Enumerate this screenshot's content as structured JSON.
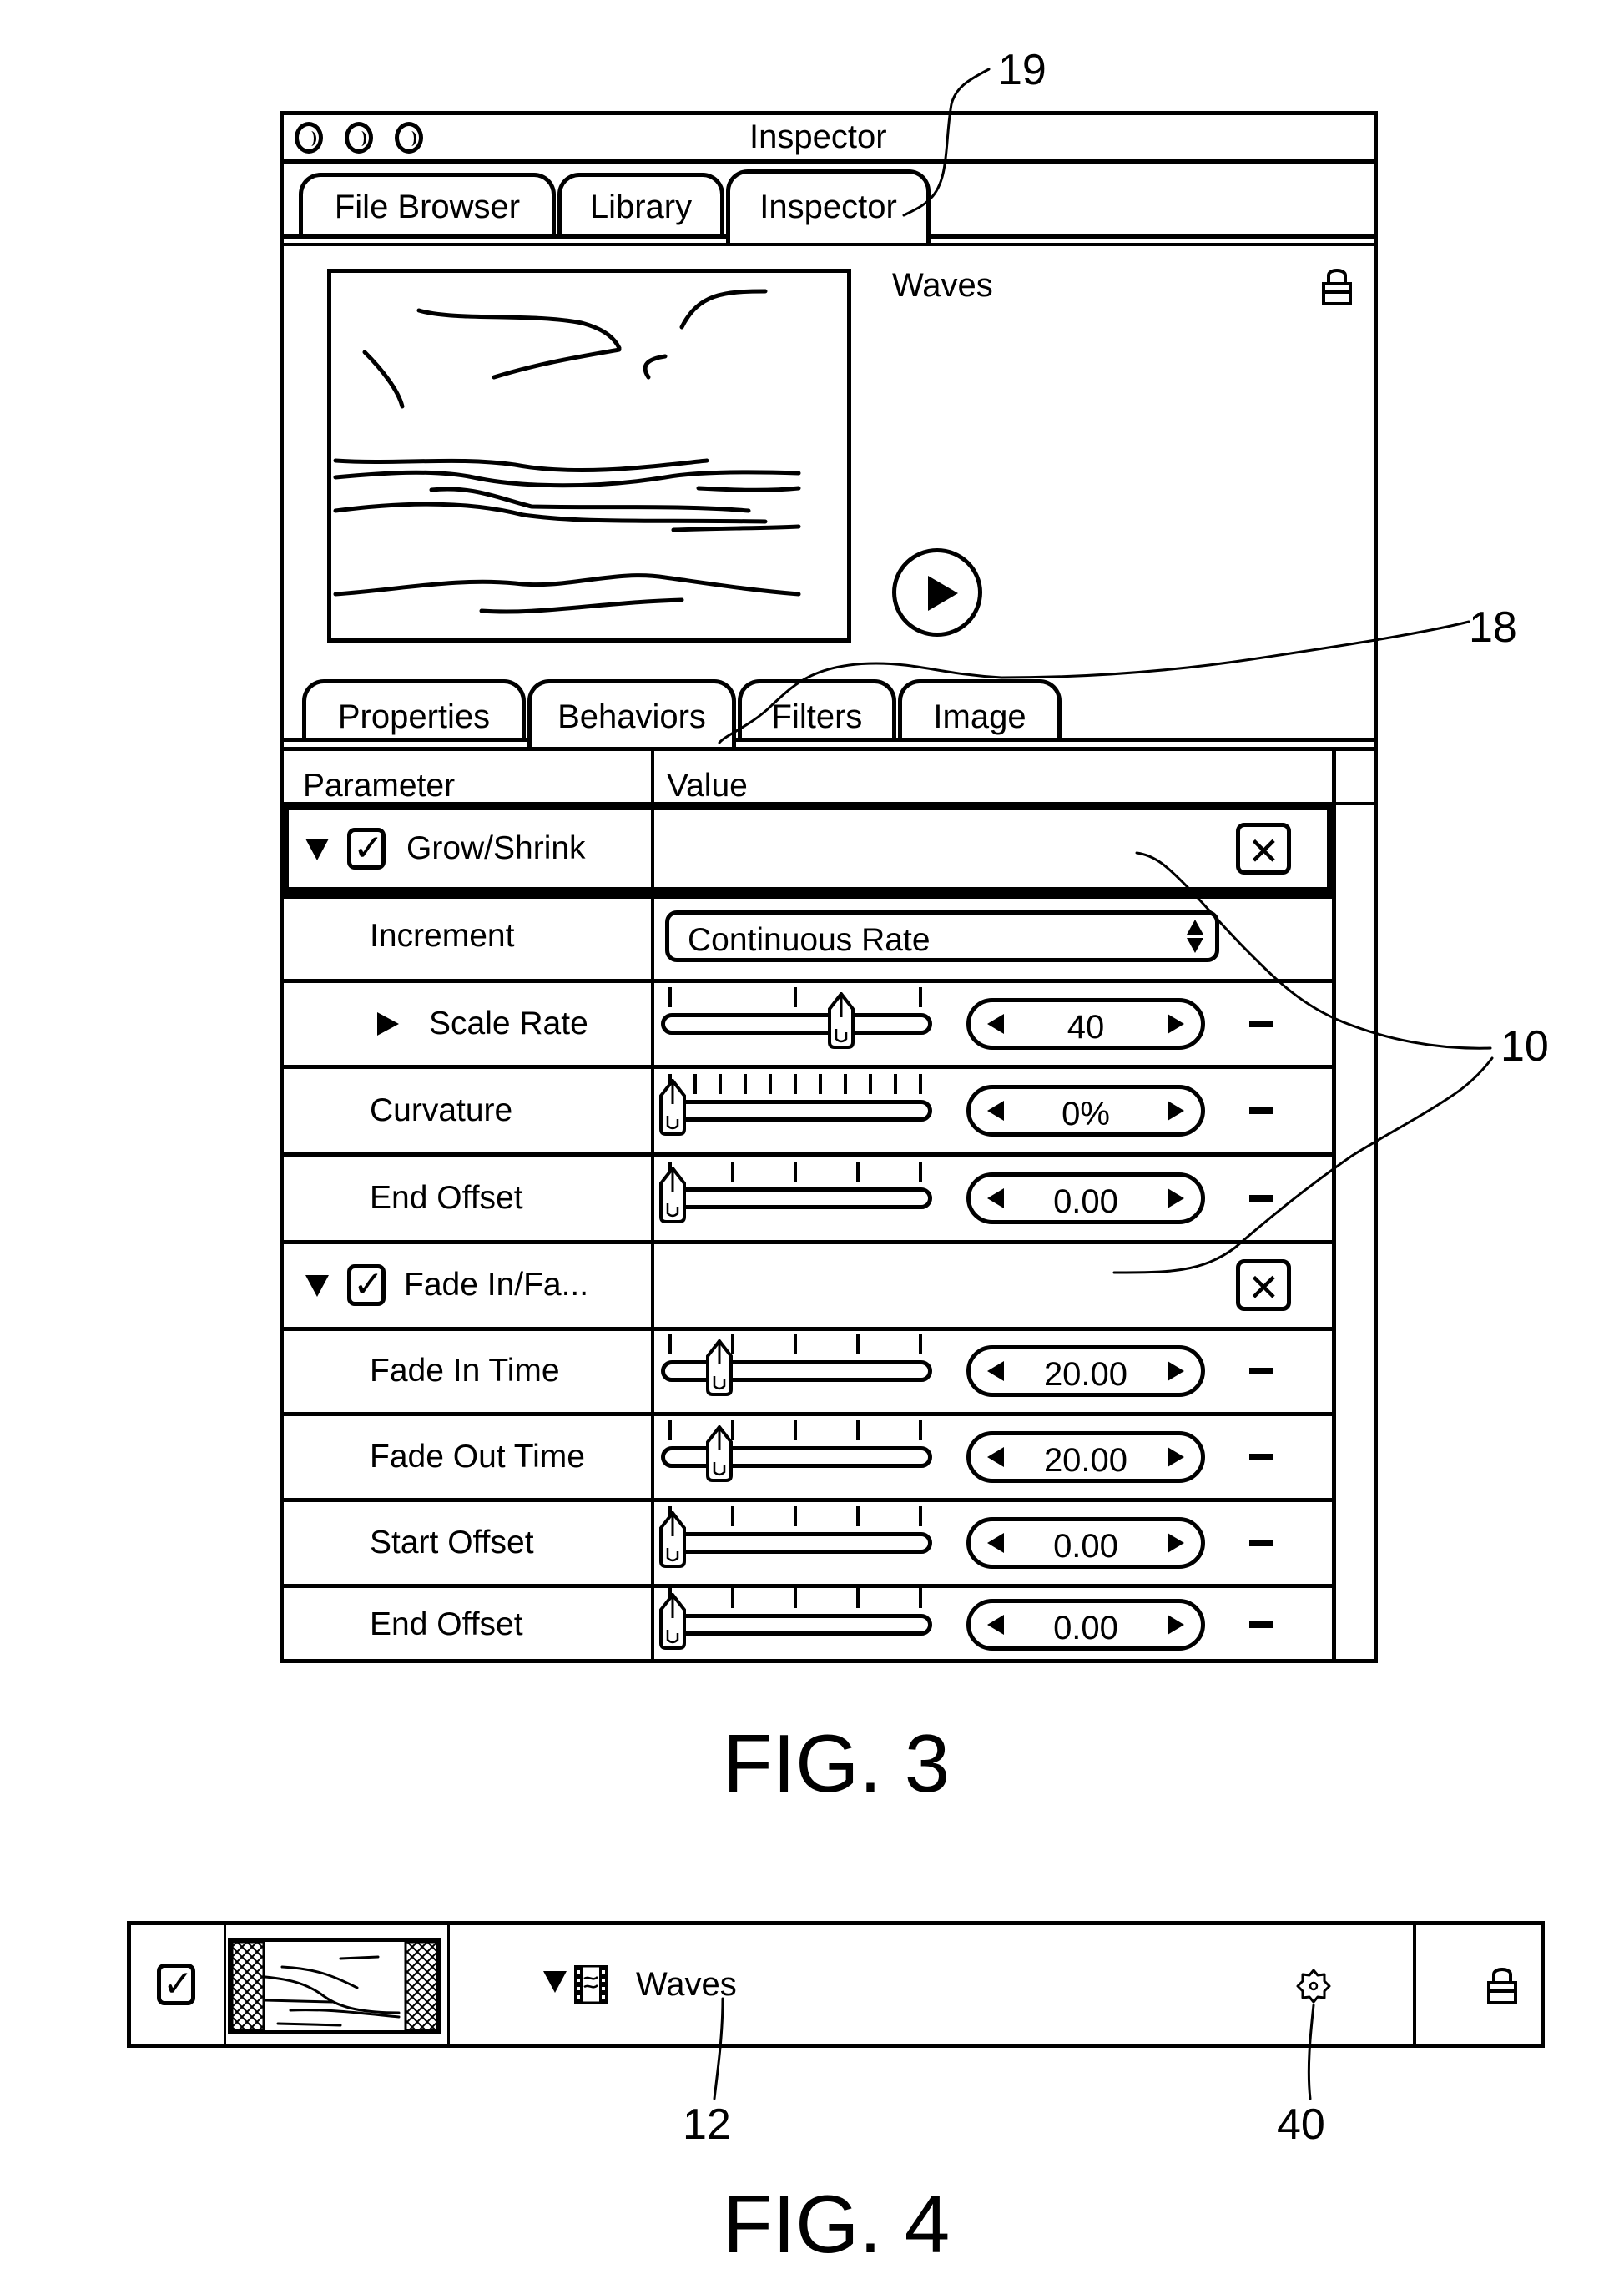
{
  "fig3": {
    "figure_label": "FIG. 3",
    "window": {
      "title": "Inspector",
      "traffic_lights": [
        "close",
        "minimize",
        "zoom"
      ],
      "top_tabs": [
        {
          "label": "File Browser",
          "active": false
        },
        {
          "label": "Library",
          "active": false
        },
        {
          "label": "Inspector",
          "active": true
        }
      ],
      "preview": {
        "name": "Waves",
        "lock_icon": "unlocked-padlock-icon",
        "play_icon": "play-button-icon"
      },
      "sub_tabs": [
        {
          "label": "Properties",
          "active": false
        },
        {
          "label": "Behaviors",
          "active": true
        },
        {
          "label": "Filters",
          "active": false
        },
        {
          "label": "Image",
          "active": false
        }
      ],
      "table": {
        "headers": {
          "parameter": "Parameter",
          "value": "Value"
        },
        "rows": [
          {
            "type": "group",
            "label": "Grow/Shrink",
            "expanded": true,
            "enabled": true,
            "selected": true
          },
          {
            "type": "popup",
            "label": "Increment",
            "value": "Continuous Rate"
          },
          {
            "type": "slider",
            "label": "Scale Rate",
            "disclosure": "collapsed",
            "value": "40",
            "slider_fraction": 0.68,
            "ticks": 3
          },
          {
            "type": "slider",
            "label": "Curvature",
            "value": "0%",
            "slider_fraction": 0.0,
            "ticks": 11
          },
          {
            "type": "slider",
            "label": "End Offset",
            "value": "0.00",
            "slider_fraction": 0.0,
            "ticks": 5
          },
          {
            "type": "group",
            "label": "Fade In/Fa...",
            "expanded": true,
            "enabled": true,
            "selected": false
          },
          {
            "type": "slider",
            "label": "Fade In Time",
            "value": "20.00",
            "slider_fraction": 0.19,
            "ticks": 5
          },
          {
            "type": "slider",
            "label": "Fade Out Time",
            "value": "20.00",
            "slider_fraction": 0.19,
            "ticks": 5
          },
          {
            "type": "slider",
            "label": "Start Offset",
            "value": "0.00",
            "slider_fraction": 0.0,
            "ticks": 5
          },
          {
            "type": "slider",
            "label": "End Offset",
            "value": "0.00",
            "slider_fraction": 0.0,
            "ticks": 5
          }
        ]
      }
    },
    "reference_numerals": {
      "inspector_tab": "19",
      "behaviors_tab": "18",
      "behaviors": "10"
    }
  },
  "fig4": {
    "figure_label": "FIG. 4",
    "layer_row": {
      "enabled": true,
      "name": "Waves",
      "expanded": true,
      "type_icon": "film-clip-icon",
      "behavior_icon": "gear-icon",
      "lock_icon": "unlocked-padlock-icon"
    },
    "reference_numerals": {
      "layer_name": "12",
      "behavior_icon": "40"
    }
  }
}
